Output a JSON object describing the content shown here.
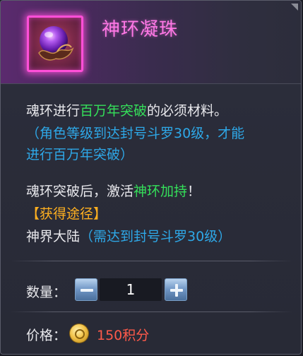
{
  "item": {
    "name": "神环凝珠",
    "icon": "purple-orb-icon"
  },
  "description": {
    "line1": {
      "pre": "魂环进行",
      "highlight": "百万年突破",
      "post": "的必须材料。"
    },
    "requirement_line1": "（角色等级到达封号斗罗30级，才能",
    "requirement_line2": "进行百万年突破）",
    "effect": {
      "pre": "魂环突破后，激活",
      "highlight": "神环加持",
      "post": "！"
    },
    "source_title": "【获得途径】",
    "source": {
      "place": "神界大陆",
      "condition": "（需达到封号斗罗30级）"
    }
  },
  "quantity": {
    "label": "数量：",
    "value": "1",
    "minus_icon": "minus-icon",
    "plus_icon": "plus-icon"
  },
  "price": {
    "label": "价格：",
    "value": "150积分",
    "icon": "coin-icon"
  },
  "colors": {
    "title": "#ff78e6",
    "highlight_green": "#35e05a",
    "note_blue": "#2ea8e8",
    "source_orange": "#ffb020",
    "price_red": "#ff5a4a"
  }
}
